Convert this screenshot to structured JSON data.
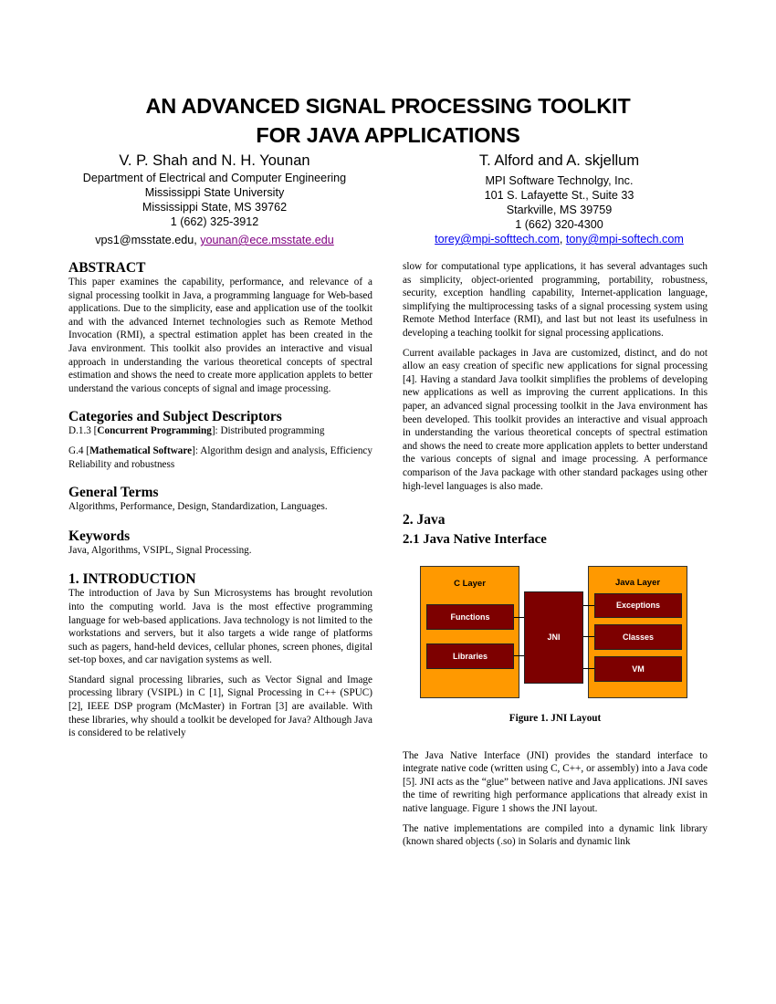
{
  "title": {
    "line1": "AN ADVANCED SIGNAL PROCESSING TOOLKIT",
    "line2": "FOR JAVA APPLICATIONS"
  },
  "authors_left": {
    "names": "V. P. Shah and N. H. Younan",
    "affiliation": [
      "Department of Electrical and Computer Engineering",
      "Mississippi State University",
      "Mississippi State, MS 39762"
    ],
    "phone": "1 (662) 325-3912",
    "email_plain": "vps1@msstate.edu, ",
    "email_link": "younan@ece.msstate.edu"
  },
  "authors_right": {
    "names": "T. Alford and A. skjellum",
    "affiliation": [
      "MPI Software Technolgy, Inc.",
      "101 S. Lafayette St., Suite 33",
      "Starkville, MS 39759"
    ],
    "phone": "1 (662) 320-4300",
    "email_link_1": "torey@mpi-softtech.com",
    "email_sep": ", ",
    "email_link_2": "tony@mpi-softech.com"
  },
  "left_column": {
    "abstract_heading": "ABSTRACT",
    "abstract_text": "This paper examines the capability, performance, and relevance of a signal processing toolkit in Java, a programming language for Web-based applications. Due to the simplicity, ease and application use of the toolkit and with the advanced Internet technologies such as Remote Method Invocation (RMI), a spectral estimation applet has been created in the Java environment. This toolkit also provides an interactive and visual approach in understanding the various theoretical concepts of spectral estimation and shows the need to create more application applets to better understand the various concepts of signal and image processing.",
    "categories_heading": "Categories and Subject Descriptors",
    "cat1_prefix": "D.1.3 [",
    "cat1_bold": "Concurrent Programming",
    "cat1_suffix": "]: Distributed programming",
    "cat2_prefix": "G.4 [",
    "cat2_bold": "Mathematical Software",
    "cat2_suffix": "]: Algorithm design and analysis, Efficiency Reliability and robustness",
    "general_heading": "General Terms",
    "general_text": "Algorithms, Performance, Design, Standardization, Languages.",
    "keywords_heading": "Keywords",
    "keywords_text": "Java, Algorithms, VSIPL, Signal Processing.",
    "intro_heading": "1.  INTRODUCTION",
    "intro_p1": "The introduction of Java by Sun Microsystems has brought revolution into the computing world. Java is the most effective programming language for web-based applications. Java technology is not limited to the workstations and servers, but it also targets a wide range of platforms such as pagers, hand-held devices, cellular phones, screen phones, digital set-top boxes, and car navigation systems as well.",
    "intro_p2": "Standard signal processing libraries, such as Vector Signal and Image processing library (VSIPL) in C [1], Signal Processing in C++ (SPUC) [2], IEEE DSP program (McMaster) in Fortran [3] are available. With these libraries, why should a toolkit be developed for Java? Although Java is considered to be relatively"
  },
  "right_column": {
    "p1": "slow for computational type applications, it has several advantages such as simplicity, object-oriented programming, portability, robustness, security, exception handling capability, Internet-application language, simplifying the multiprocessing tasks of a signal processing system using Remote Method Interface (RMI), and last but not least its usefulness in developing a teaching toolkit for signal processing applications.",
    "p2": "Current available packages in Java are customized, distinct, and do not allow an easy creation of specific new applications for signal processing [4]. Having a standard Java toolkit simplifies the problems of developing new applications as well as improving the current applications. In this paper, an advanced signal processing toolkit in the Java environment has been developed. This toolkit provides an interactive and visual approach in understanding the various theoretical concepts of spectral estimation and shows the need to create more application applets to better understand the various concepts of signal and image processing. A performance comparison of the Java package with other standard packages using other high-level languages is also made.",
    "section2_heading": "2.  Java",
    "section21_heading": "2.1  Java Native Interface",
    "figure": {
      "c_layer_title": "C Layer",
      "c_layer_items": [
        "Functions",
        "Libraries"
      ],
      "jni_label": "JNI",
      "java_layer_title": "Java Layer",
      "java_layer_items": [
        "Exceptions",
        "Classes",
        "VM"
      ],
      "colors": {
        "layer": "#ff9900",
        "box": "#7d0000",
        "box_text": "#ffffff"
      },
      "caption": "Figure 1.  JNI Layout"
    },
    "p3": "The Java Native Interface (JNI) provides the standard interface to integrate native code (written using C, C++, or assembly) into a Java code [5]. JNI acts as the “glue” between native and Java applications. JNI saves the time of rewriting high performance applications that already exist in native language. Figure 1 shows the JNI layout.",
    "p4": "The native implementations are compiled into a dynamic link library (known shared objects (.so) in Solaris and dynamic link"
  }
}
